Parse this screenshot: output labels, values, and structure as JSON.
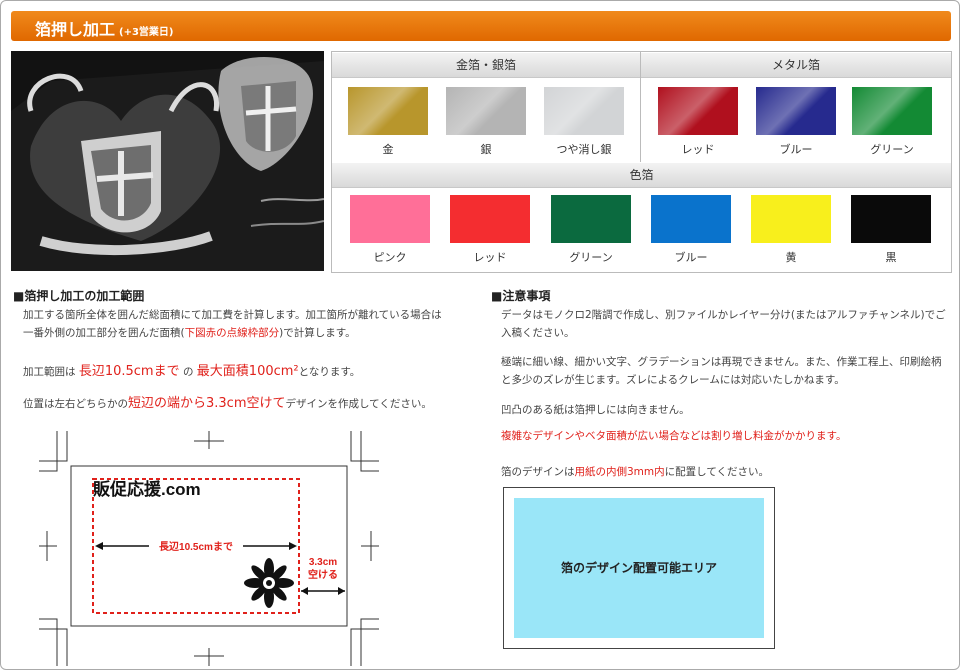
{
  "header": {
    "title": "箔押し加工",
    "subtitle": "(+3営業日)"
  },
  "swatches": {
    "group1": {
      "label": "金箔・銀箔",
      "items": [
        {
          "name": "金",
          "color": "#b8962c"
        },
        {
          "name": "銀",
          "color": "#b4b4b4"
        },
        {
          "name": "つや消し銀",
          "color": "#d2d4d6"
        }
      ]
    },
    "group2": {
      "label": "メタル箔",
      "items": [
        {
          "name": "レッド",
          "color": "#b0101e"
        },
        {
          "name": "ブルー",
          "color": "#262a8e"
        },
        {
          "name": "グリーン",
          "color": "#138a34"
        }
      ]
    },
    "group3": {
      "label": "色箔",
      "items": [
        {
          "name": "ピンク",
          "color": "#ff6f98"
        },
        {
          "name": "レッド",
          "color": "#f42d30"
        },
        {
          "name": "グリーン",
          "color": "#0b6a3f"
        },
        {
          "name": "ブルー",
          "color": "#0a73cc"
        },
        {
          "name": "黄",
          "color": "#f8ef1c"
        },
        {
          "name": "黒",
          "color": "#0a0a0a"
        }
      ]
    }
  },
  "range": {
    "heading": "■箔押し加工の加工範囲",
    "p1_line1": "加工する箇所全体を囲んだ総面積にて加工費を計算します。加工箇所が離れている場合は",
    "p1_line2_a": "一番外側の加工部分を囲んだ面積(",
    "p1_line2_red": "下図赤の点線枠部分",
    "p1_line2_b": ")で計算します。",
    "p2_a": "加工範囲は",
    "p2_red1": "長辺10.5cmまで",
    "p2_b": "の",
    "p2_red2": "最大面積100cm²",
    "p2_c": "となります。",
    "p3_a": "位置は左右どちらかの",
    "p3_red": "短辺の端から3.3cm空けて",
    "p3_b": "デザインを作成してください。"
  },
  "diagram": {
    "brand": "販促応援.com",
    "length_label": "長辺10.5cmまで",
    "gap_label_1": "3.3cm",
    "gap_label_2": "空ける"
  },
  "notes": {
    "heading": "■注意事項",
    "n1_line1": "データはモノクロ2階調で作成し、別ファイルかレイヤー分け(またはアルファチャンネル)でご",
    "n1_line2": "入稿ください。",
    "n2_line1": "極端に細い線、細かい文字、グラデーションは再現できません。また、作業工程上、印刷絵柄",
    "n2_line2": "と多少のズレが生じます。ズレによるクレームには対応いたしかねます。",
    "n3": "凹凸のある紙は箔押しには向きません。",
    "n4": "複雑なデザインやベタ面積が広い場合などは割り増し料金がかかります。",
    "n5_a": "箔のデザインは",
    "n5_red": "用紙の内側3mm内",
    "n5_b": "に配置してください。",
    "area_label": "箔のデザイン配置可能エリア"
  }
}
